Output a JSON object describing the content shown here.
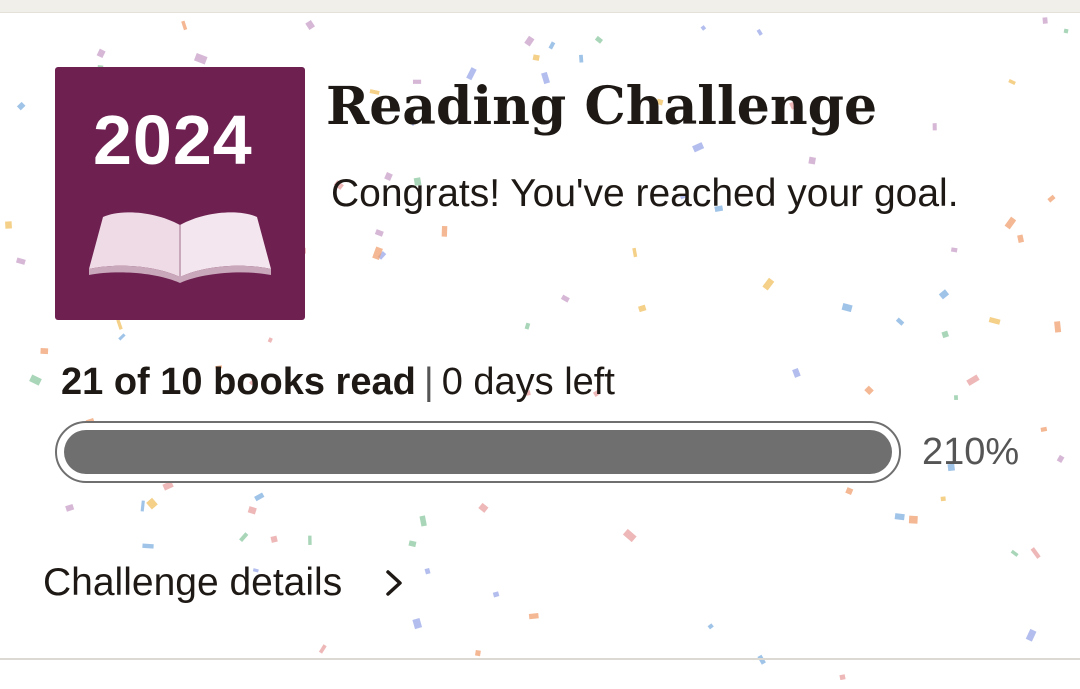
{
  "cover": {
    "year": "2024",
    "background_color": "#6e2151",
    "icon": "open-book-icon"
  },
  "header": {
    "title": "Reading Challenge",
    "message": "Congrats! You've reached your goal."
  },
  "progress": {
    "books_read": "21 of 10 books read",
    "separator": "|",
    "days_left": "0 days left",
    "percent_label": "210%",
    "fill_fraction": 1.0,
    "bar_color": "#6f6f6f"
  },
  "details_link": {
    "label": "Challenge details",
    "icon": "chevron-right-icon"
  },
  "decoration": {
    "confetti_colors": [
      "#e8a0a0",
      "#9aa8e8",
      "#8cc8a0",
      "#f0c060",
      "#c8a0c8",
      "#f0a070",
      "#80b0e0"
    ]
  }
}
